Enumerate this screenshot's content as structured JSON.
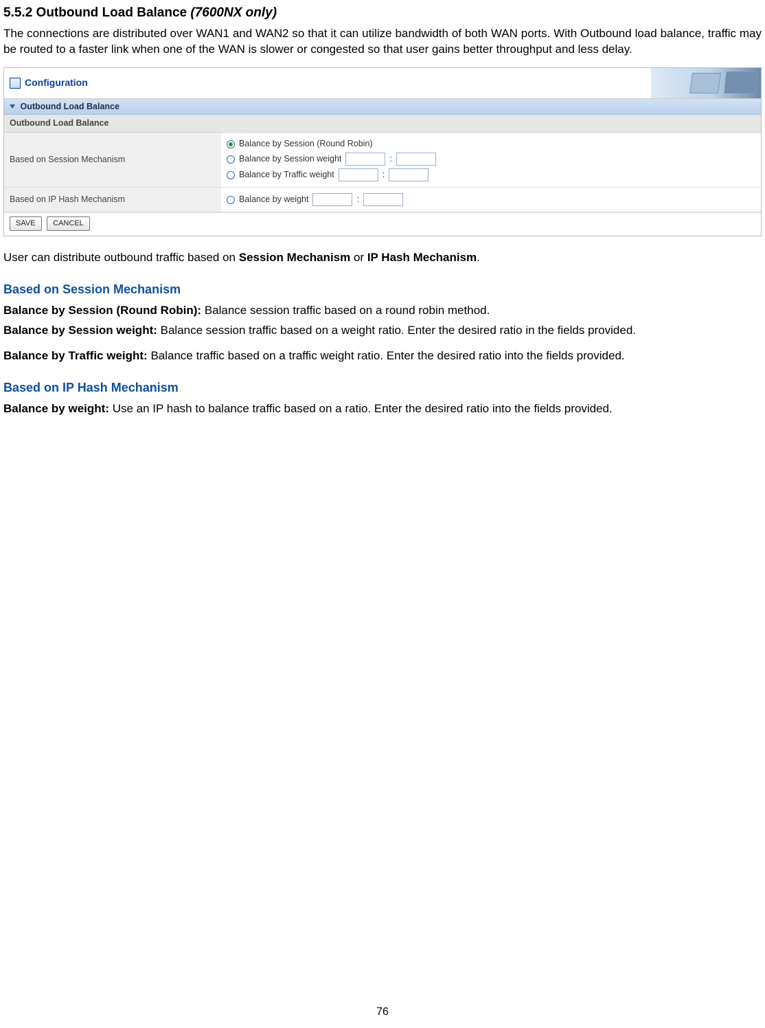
{
  "doc": {
    "section_number": "5.5.2",
    "section_title_plain": "Outbound Load Balance",
    "section_title_italic": "(7600NX only)",
    "intro_para": "The connections are distributed over WAN1 and WAN2 so that it can utilize bandwidth of both WAN ports. With Outbound load balance, traffic may be routed to a faster link when one of the WAN is slower or congested so that user gains better throughput and less delay.",
    "distribute_prefix": "User can distribute outbound traffic based on ",
    "distribute_bold1": "Session Mechanism",
    "distribute_mid": " or ",
    "distribute_bold2": "IP Hash Mechanism",
    "distribute_suffix": ".",
    "heading_session": "Based on Session Mechanism",
    "sess_rr_label": "Balance by Session (Round Robin):",
    "sess_rr_text": " Balance session traffic based on a round robin method.",
    "sess_w_label": "Balance by Session weight:",
    "sess_w_text": " Balance session traffic based on a weight ratio. Enter the desired ratio in the fields provided.",
    "traf_w_label": "Balance by Traffic weight:",
    "traf_w_text": " Balance traffic based on a traffic weight ratio. Enter the desired ratio into the fields provided.",
    "heading_iphash": "Based on IP Hash Mechanism",
    "ip_w_label": "Balance by weight:",
    "ip_w_text": " Use an IP hash to balance traffic based on a ratio. Enter the desired ratio into the fields provided.",
    "page_number": "76"
  },
  "shot": {
    "header_title": "Configuration",
    "section_title": "Outbound Load Balance",
    "subsection_title": "Outbound Load Balance",
    "row1_label": "Based on Session Mechanism",
    "row2_label": "Based on IP Hash Mechanism",
    "opt_session_rr": "Balance by Session (Round Robin)",
    "opt_session_weight": "Balance by Session weight",
    "opt_traffic_weight": "Balance by Traffic weight",
    "opt_balance_weight": "Balance by weight",
    "ratio_sep": ":",
    "save_btn": "SAVE",
    "cancel_btn": "CANCEL"
  }
}
